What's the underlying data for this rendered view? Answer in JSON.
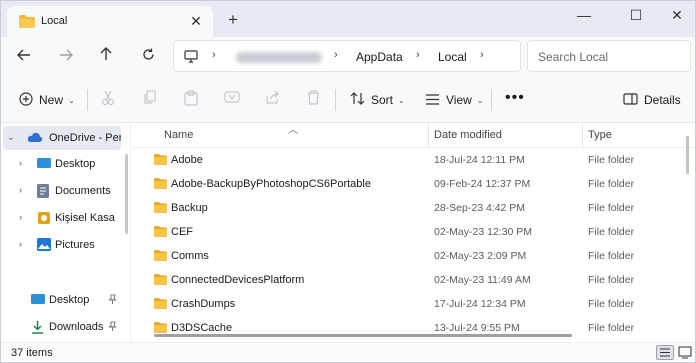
{
  "window": {
    "tab_title": "Local",
    "new_tab": "+",
    "minimize": "—",
    "maximize": "☐",
    "close": "✕"
  },
  "address": {
    "breadcrumb": [
      "AppData",
      "Local"
    ],
    "search_placeholder": "Search Local"
  },
  "commands": {
    "new": "New",
    "sort": "Sort",
    "view": "View",
    "more": "•••",
    "details": "Details"
  },
  "sidebar": {
    "items": [
      {
        "label": "OneDrive - Perso",
        "icon": "onedrive-icon",
        "color": "#2f6fd1"
      },
      {
        "label": "Desktop",
        "icon": "desktop-folder-icon",
        "color": "#2e8fd8"
      },
      {
        "label": "Documents",
        "icon": "documents-folder-icon",
        "color": "#6f7e92"
      },
      {
        "label": "Kişisel Kasa",
        "icon": "personal-vault-icon",
        "color": "#e0a21c"
      },
      {
        "label": "Pictures",
        "icon": "pictures-folder-icon",
        "color": "#1e78d6"
      },
      {
        "label": "Desktop",
        "icon": "desktop-folder-icon",
        "color": "#2e8fd8"
      },
      {
        "label": "Downloads",
        "icon": "downloads-icon",
        "color": "#1a8a4a"
      }
    ]
  },
  "columns": {
    "name": "Name",
    "date": "Date modified",
    "type": "Type"
  },
  "files": [
    {
      "name": "Adobe",
      "date": "18-Jul-24 12:11 PM",
      "type": "File folder"
    },
    {
      "name": "Adobe-BackupByPhotoshopCS6Portable",
      "date": "09-Feb-24 12:37 PM",
      "type": "File folder"
    },
    {
      "name": "Backup",
      "date": "28-Sep-23 4:42 PM",
      "type": "File folder"
    },
    {
      "name": "CEF",
      "date": "02-May-23 12:30 PM",
      "type": "File folder"
    },
    {
      "name": "Comms",
      "date": "02-May-23 2:09 PM",
      "type": "File folder"
    },
    {
      "name": "ConnectedDevicesPlatform",
      "date": "02-May-23 11:49 AM",
      "type": "File folder"
    },
    {
      "name": "CrashDumps",
      "date": "17-Jul-24 12:34 PM",
      "type": "File folder"
    },
    {
      "name": "D3DSCache",
      "date": "13-Jul-24 9:55 PM",
      "type": "File folder"
    }
  ],
  "status": {
    "item_count": "37 items"
  },
  "colors": {
    "accent": "#2b5797",
    "folder": "#f2b93b"
  }
}
